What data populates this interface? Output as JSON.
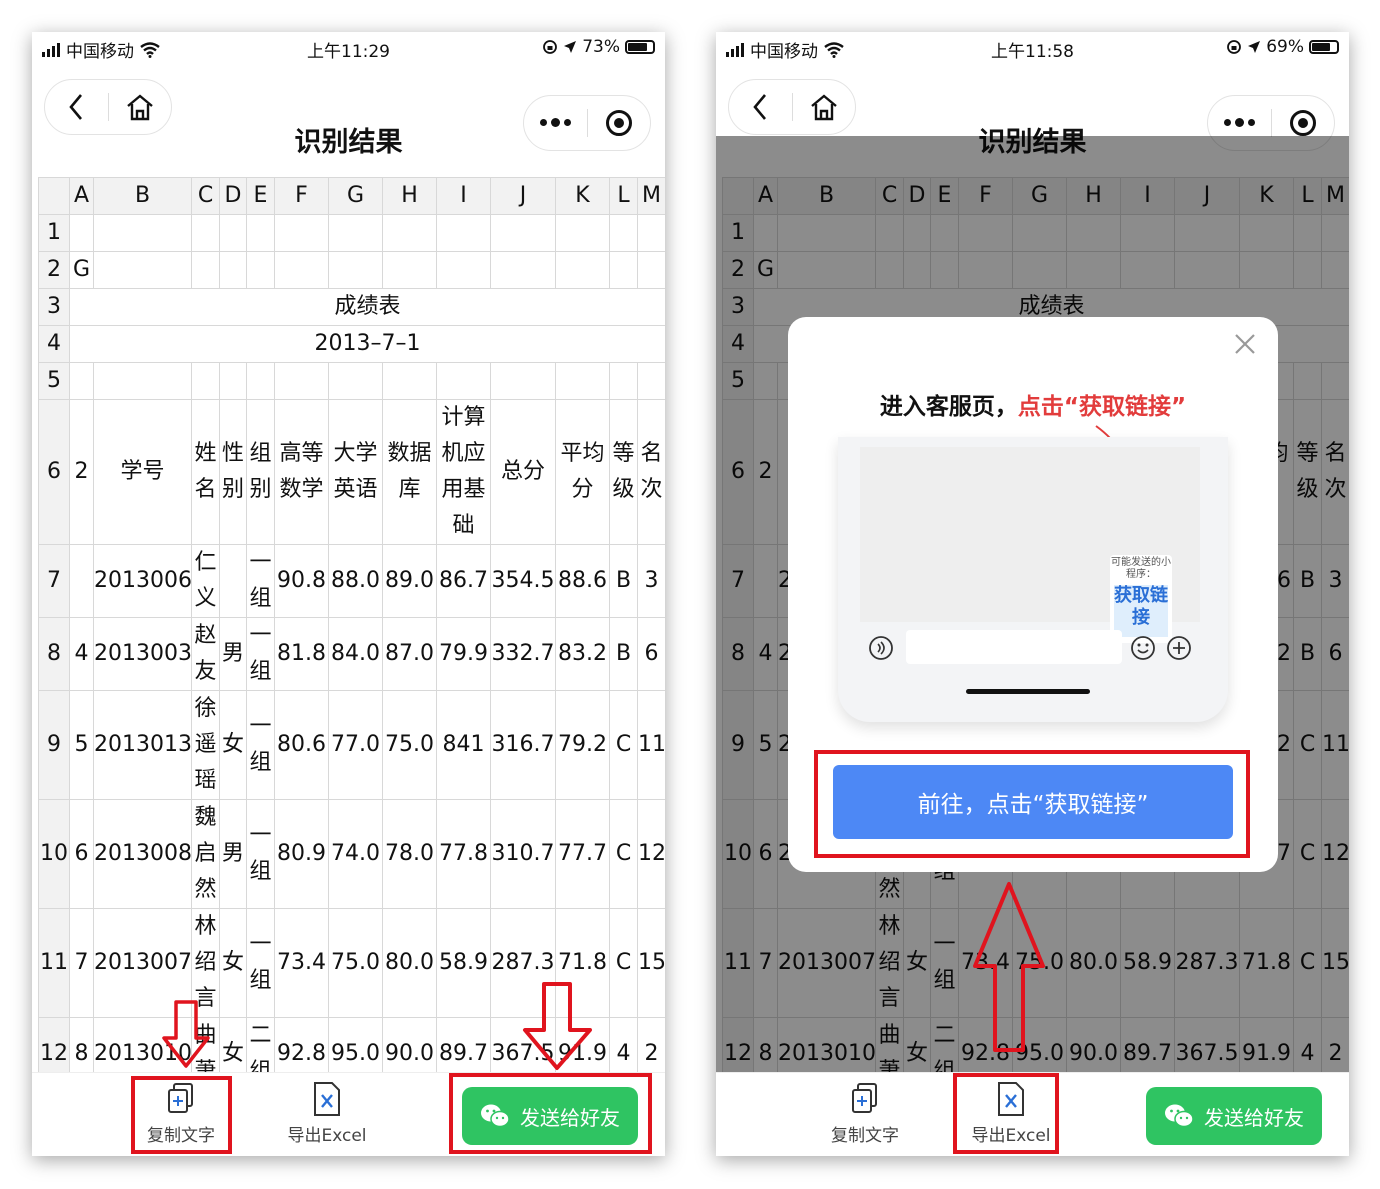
{
  "colors": {
    "accent_green": "#2fc462",
    "accent_blue": "#4d88f5",
    "highlight_red": "#e0141e",
    "prompt_red": "#e23c3c"
  },
  "phone_left": {
    "status": {
      "carrier": "中国移动",
      "time": "上午11:29",
      "battery": "73%",
      "battery_level": 0.73
    },
    "title": "识别结果"
  },
  "phone_right": {
    "status": {
      "carrier": "中国移动",
      "time": "上午11:58",
      "battery": "69%",
      "battery_level": 0.69
    },
    "title": "识别结果"
  },
  "sheet": {
    "columns": [
      "A",
      "B",
      "C",
      "D",
      "E",
      "F",
      "G",
      "H",
      "I",
      "J",
      "K",
      "L",
      "M"
    ],
    "row_numbers": [
      "1",
      "2",
      "3",
      "4",
      "5",
      "6",
      "7",
      "8",
      "9",
      "10",
      "11",
      "12"
    ],
    "r2_a": "G",
    "title": "成绩表",
    "date": "2013–7–1",
    "header": [
      "2",
      "学号",
      "姓名",
      "性别",
      "组别",
      "高等数学",
      "大学英语",
      "数据库",
      "计算机应用基础",
      "总分",
      "平均分",
      "等级",
      "名次"
    ],
    "rows": [
      [
        "",
        "2013006",
        "仁义",
        "",
        "一组",
        "90.8",
        "88.0",
        "89.0",
        "86.7",
        "354.5",
        "88.6",
        "B",
        "3"
      ],
      [
        "4",
        "2013003",
        "赵友",
        "男",
        "一组",
        "81.8",
        "84.0",
        "87.0",
        "79.9",
        "332.7",
        "83.2",
        "B",
        "6"
      ],
      [
        "5",
        "2013013",
        "徐遥瑶",
        "女",
        "一组",
        "80.6",
        "77.0",
        "75.0",
        "841",
        "316.7",
        "79.2",
        "C",
        "11"
      ],
      [
        "6",
        "2013008",
        "魏启然",
        "男",
        "一组",
        "80.9",
        "74.0",
        "78.0",
        "77.8",
        "310.7",
        "77.7",
        "C",
        "12"
      ],
      [
        "7",
        "2013007",
        "林绍言",
        "女",
        "一组",
        "73.4",
        "75.0",
        "80.0",
        "58.9",
        "287.3",
        "71.8",
        "C",
        "15"
      ],
      [
        "8",
        "2013010",
        "曲萧",
        "女",
        "二组",
        "92.8",
        "95.0",
        "90.0",
        "89.7",
        "367.5",
        "91.9",
        "4",
        "2"
      ]
    ]
  },
  "bottom_bar": {
    "copy_text": "复制文字",
    "export_excel": "导出Excel",
    "send_friend": "发送给好友"
  },
  "modal": {
    "prompt_prefix": "进入客服页，",
    "prompt_highlight": "点击“获取链接”",
    "mini_card_caption": "可能发送的小程序：",
    "mini_card_button": "获取链接",
    "go_button": "前往，点击“获取链接”"
  }
}
